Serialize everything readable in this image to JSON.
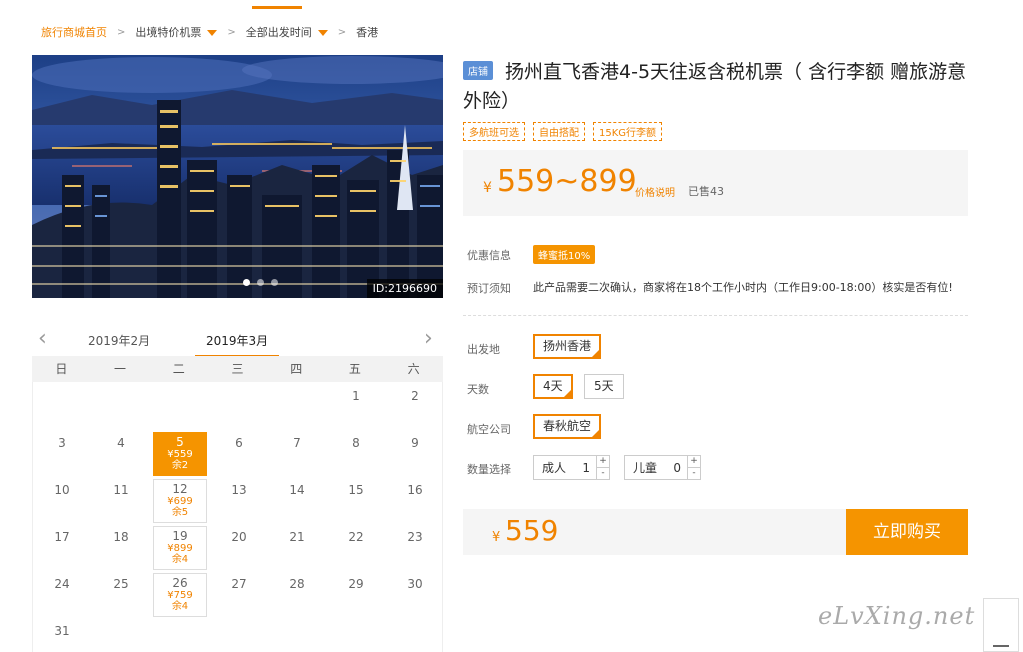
{
  "breadcrumb": {
    "home": "旅行商城首页",
    "item1": "出境特价机票",
    "item2": "全部出发时间",
    "current": "香港",
    "separator": ">"
  },
  "hero": {
    "id_label": "ID:2196690",
    "slides": 3,
    "active_slide": 1
  },
  "calendar": {
    "prev_month": "2019年2月",
    "current_month": "2019年3月",
    "weekdays": [
      "日",
      "一",
      "二",
      "三",
      "四",
      "五",
      "六"
    ],
    "rows": [
      [
        {
          "d": ""
        },
        {
          "d": ""
        },
        {
          "d": ""
        },
        {
          "d": ""
        },
        {
          "d": ""
        },
        {
          "d": "1"
        },
        {
          "d": "2"
        }
      ],
      [
        {
          "d": "3"
        },
        {
          "d": "4"
        },
        {
          "d": "5",
          "p": "¥559",
          "r": "余2",
          "sel": true
        },
        {
          "d": "6"
        },
        {
          "d": "7"
        },
        {
          "d": "8"
        },
        {
          "d": "9"
        }
      ],
      [
        {
          "d": "10"
        },
        {
          "d": "11"
        },
        {
          "d": "12",
          "p": "¥699",
          "r": "余5"
        },
        {
          "d": "13"
        },
        {
          "d": "14"
        },
        {
          "d": "15"
        },
        {
          "d": "16"
        }
      ],
      [
        {
          "d": "17"
        },
        {
          "d": "18"
        },
        {
          "d": "19",
          "p": "¥899",
          "r": "余4"
        },
        {
          "d": "20"
        },
        {
          "d": "21"
        },
        {
          "d": "22"
        },
        {
          "d": "23"
        }
      ],
      [
        {
          "d": "24"
        },
        {
          "d": "25"
        },
        {
          "d": "26",
          "p": "¥759",
          "r": "余4"
        },
        {
          "d": "27"
        },
        {
          "d": "28"
        },
        {
          "d": "29"
        },
        {
          "d": "30"
        }
      ],
      [
        {
          "d": "31"
        },
        {
          "d": ""
        },
        {
          "d": ""
        },
        {
          "d": ""
        },
        {
          "d": ""
        },
        {
          "d": ""
        },
        {
          "d": ""
        }
      ]
    ]
  },
  "product": {
    "shop_badge": "店铺",
    "title": "扬州直飞香港4-5天往返含税机票（ 含行李额 赠旅游意外险）",
    "tags": [
      "多航班可选",
      "自由搭配",
      "15KG行李额"
    ],
    "currency": "¥",
    "price_range": "559~899",
    "price_note": "价格说明",
    "sold": "已售43"
  },
  "info": {
    "discount_label": "优惠信息",
    "discount_value": "蜂蜜抵10%",
    "notice_label": "预订须知",
    "notice_text": "此产品需要二次确认，商家将在18个工作小时内（工作日9:00-18:00）核实是否有位!"
  },
  "options": {
    "departure_label": "出发地",
    "departure_value": "扬州香港",
    "days_label": "天数",
    "days": [
      "4天",
      "5天"
    ],
    "airline_label": "航空公司",
    "airline_value": "春秋航空",
    "quantity_label": "数量选择",
    "adult_label": "成人",
    "adult_value": "1",
    "child_label": "儿童",
    "child_value": "0",
    "plus": "+",
    "minus": "-"
  },
  "buy": {
    "currency": "¥",
    "price": "559",
    "button": "立即购买"
  },
  "watermark": "eLvXing.net",
  "colors": {
    "accent": "#f08300",
    "button": "#f59400",
    "shop_badge": "#5b8fd6"
  }
}
